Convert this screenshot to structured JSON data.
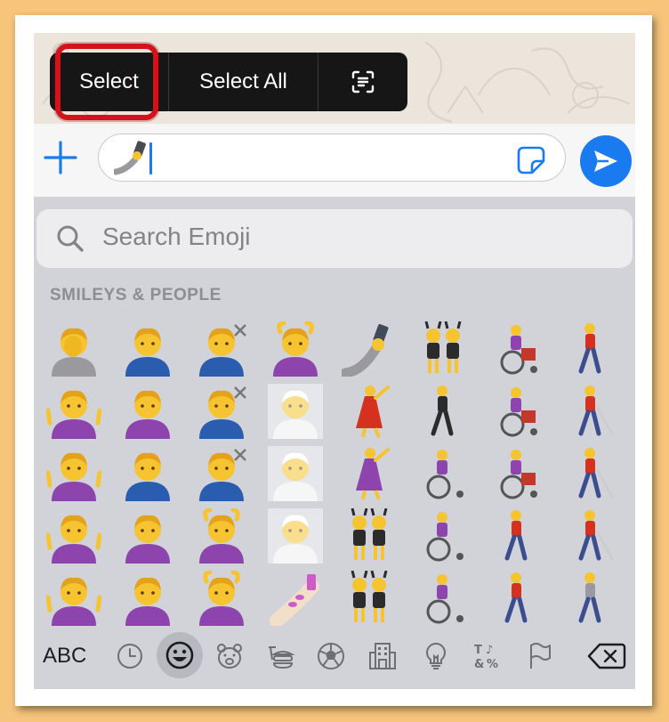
{
  "context_menu": {
    "select_label": "Select",
    "select_all_label": "Select All",
    "scan_icon": "text-scan-icon"
  },
  "input": {
    "current_value_emoji": "selfie-arm",
    "sticker_icon": "sticker-icon",
    "send_icon": "send-arrow-icon",
    "plus_icon": "plus-icon"
  },
  "keyboard": {
    "search_placeholder": "Search Emoji",
    "section_title": "SMILEYS & PEOPLE",
    "toolbar": {
      "abc_label": "ABC",
      "categories": [
        "recent-clock-icon",
        "smiley-icon",
        "bear-icon",
        "food-icon",
        "soccer-ball-icon",
        "buildings-icon",
        "lightbulb-icon",
        "symbols-icon",
        "flag-icon"
      ],
      "delete_icon": "backspace-icon"
    },
    "emoji_rows": [
      [
        "face-palm",
        "man-gesturing",
        "woman-haircut",
        "man-getting-massage",
        "selfie",
        "bunny-ears-women",
        "woman-motorized-wheelchair",
        "person-walking"
      ],
      [
        "person-shrugging",
        "man-gesturing-ok",
        "man-haircut",
        "person-in-steam",
        "woman-dancing",
        "levitating-man",
        "man-motorized-wheelchair",
        "woman-with-cane"
      ],
      [
        "man-shrugging",
        "woman-gesturing",
        "man-haircut-2",
        "woman-in-steam",
        "man-dancing",
        "woman-manual-wheelchair",
        "person-motorized-wheelchair",
        "man-with-cane"
      ],
      [
        "man-shrugging-blue",
        "person-frowning",
        "woman-getting-massage",
        "man-in-steam",
        "bunny-ears-people",
        "man-manual-wheelchair",
        "woman-walking",
        "person-with-cane"
      ],
      [
        "woman-shrugging",
        "man-frowning",
        "man-getting-massage-2",
        "nail-polish",
        "bunny-ears-men",
        "person-manual-wheelchair",
        "man-walking",
        "woman-kneeling"
      ]
    ]
  },
  "colors": {
    "accent_blue": "#1a7bf0",
    "highlight_red": "#d4121b",
    "emoji_yellow": "#f5c430"
  }
}
